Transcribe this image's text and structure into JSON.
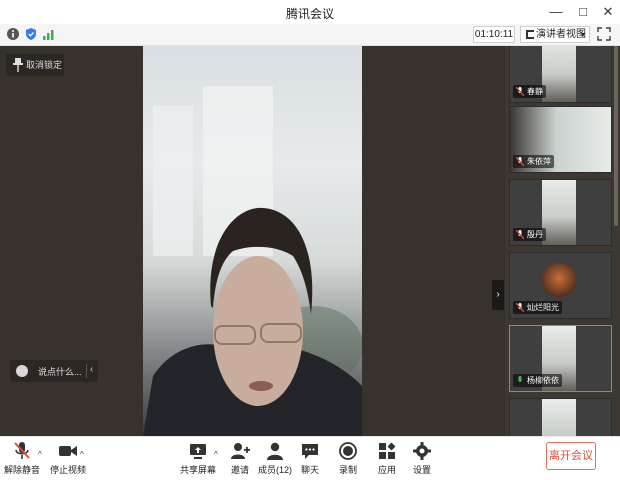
{
  "window": {
    "title": "腾讯会议",
    "minimize_glyph": "—",
    "maximize_glyph": "□",
    "close_glyph": "✕"
  },
  "toolbar": {
    "icons": [
      "info-icon",
      "shield-icon",
      "signal-icon"
    ],
    "timer": "01:10:11",
    "view_label": "演讲者视图",
    "view_caret": "▾",
    "fullscreen_icon": "fullscreen-icon",
    "accent": "#2f7cf6",
    "signal_color": "#3cb043"
  },
  "stage": {
    "lock_label": "取消锁定",
    "chat_placeholder": "说点什么...",
    "chat_chevron": "‹",
    "collapse_chevron": "›"
  },
  "gallery": {
    "up_glyph": "︿",
    "participants": [
      {
        "name": "春静",
        "muted": true,
        "active": false
      },
      {
        "name": "朱依萍",
        "muted": true,
        "active": false
      },
      {
        "name": "殷丹",
        "muted": true,
        "active": false
      },
      {
        "name": "灿烂阳光",
        "muted": true,
        "active": false
      },
      {
        "name": "杨柳依依",
        "muted": false,
        "active": true
      }
    ],
    "active_color": "#46b462",
    "muted_color": "#e14b3c"
  },
  "bottom": {
    "unmute": "解除静音",
    "stop_video": "停止视频",
    "share": "共享屏幕",
    "invite": "邀请",
    "members": "成员(12)",
    "chat": "聊天",
    "record": "录制",
    "apps": "应用",
    "settings": "设置",
    "leave": "离开会议",
    "caret": "^"
  }
}
